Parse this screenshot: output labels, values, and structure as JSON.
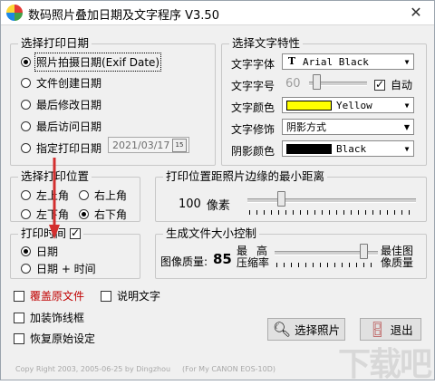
{
  "window": {
    "title": "数码照片叠加日期及文字程序  V3.50",
    "close_glyph": "✕"
  },
  "print_date": {
    "title": "选择打印日期",
    "options": [
      "照片拍摄日期(Exif Date)",
      "文件创建日期",
      "最后修改日期",
      "最后访问日期",
      "指定打印日期"
    ],
    "selected": 0,
    "specified_date": "2021/03/17",
    "calendar_glyph": "15"
  },
  "text_props": {
    "title": "选择文字特性",
    "font_label": "文字字体",
    "font_value": "Arial Black",
    "size_label": "文字字号",
    "size_value": "60",
    "auto_label": "自动",
    "color_label": "文字颜色",
    "color_name": "Yellow",
    "color_hex": "#ffff00",
    "decor_label": "文字修饰",
    "decor_value": "阴影方式",
    "shadow_label": "阴影颜色",
    "shadow_name": "Black",
    "shadow_hex": "#000000"
  },
  "position": {
    "title": "选择打印位置",
    "options": [
      "左上角",
      "右上角",
      "左下角",
      "右下角"
    ],
    "selected": 3
  },
  "margin": {
    "title": "打印位置距照片边缘的最小距离",
    "value": "100",
    "unit": "像素"
  },
  "print_time": {
    "title": "打印时间",
    "options": [
      "日期",
      "日期 + 时间"
    ],
    "selected": 0
  },
  "size_control": {
    "title": "生成文件大小控制",
    "quality_label": "图像质量:",
    "quality_value": "85",
    "low_top": "最",
    "high_top": "高",
    "low_bottom": "压缩率",
    "best_top": "最佳图",
    "best_bottom": "像质量"
  },
  "options": {
    "overwrite": "覆盖原文件",
    "caption": "说明文字",
    "border": "加装饰线框",
    "restore": "恢复原始设定"
  },
  "buttons": {
    "select_photo": "选择照片",
    "exit": "退出"
  },
  "footer": {
    "copyright": "Copy Right 2003, 2005-06-25 by Dingzhou",
    "model": "(For My CANON EOS-10D)"
  },
  "watermark": "下载吧"
}
